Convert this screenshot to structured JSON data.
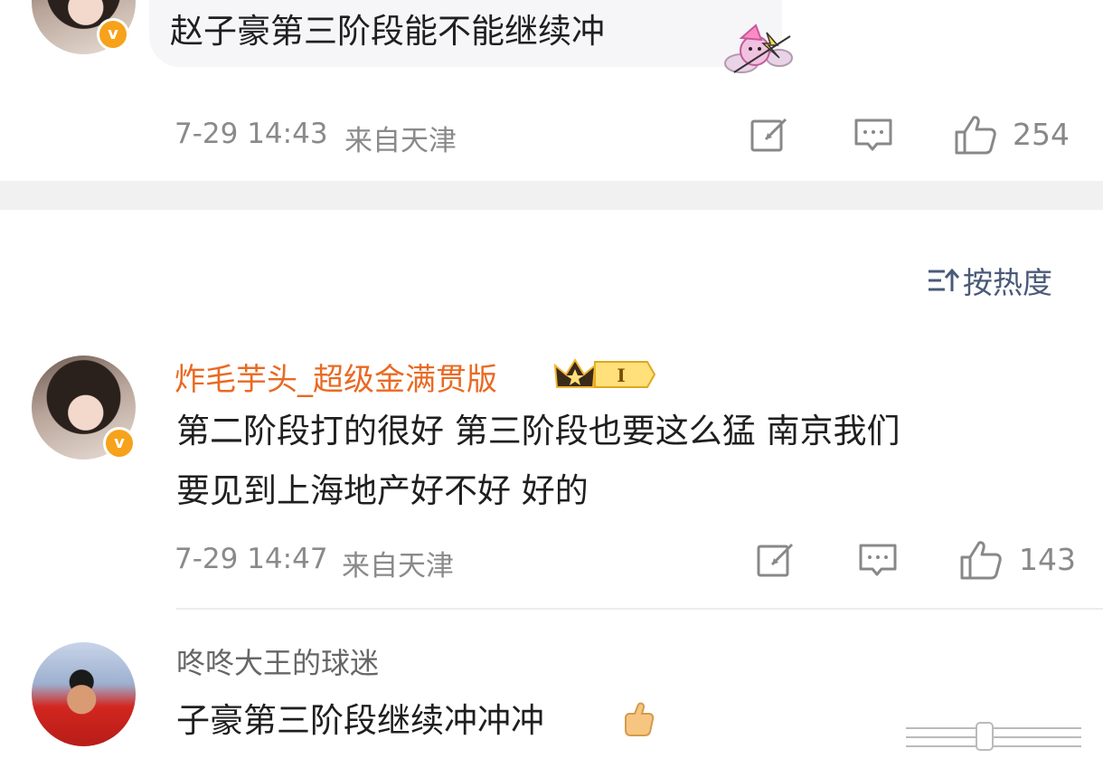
{
  "comment1": {
    "text": "赵子豪第三阶段能不能继续冲",
    "time": "7-29 14:43",
    "location": "来自天津",
    "likes": "254",
    "sticker_icon": "cupid-sticker-icon"
  },
  "sort": {
    "label": "按热度",
    "icon": "sort-icon"
  },
  "comment2": {
    "username": "炸毛芋头_超级金满贯版",
    "vip_badge_text": "I",
    "text_line1": "第二阶段打的很好 第三阶段也要这么猛 南京我们",
    "text_line2": "要见到上海地产好不好 好的",
    "time": "7-29 14:47",
    "location": "来自天津",
    "likes": "143"
  },
  "comment3": {
    "username": "咚咚大王的球迷",
    "text": "子豪第三阶段继续冲冲冲"
  },
  "colors": {
    "username_orange": "#e96a23",
    "verified_badge": "#f7a21b",
    "sort_text": "#4a5a78"
  }
}
